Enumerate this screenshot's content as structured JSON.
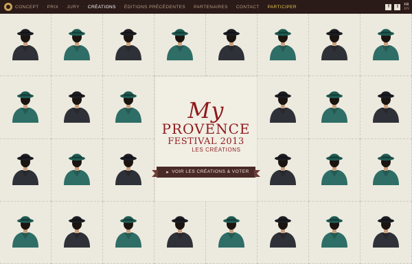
{
  "nav": {
    "items": [
      {
        "label": "Concept",
        "state": "normal"
      },
      {
        "label": "Prix",
        "state": "normal"
      },
      {
        "label": "Jury",
        "state": "normal"
      },
      {
        "label": "Créations",
        "state": "active"
      },
      {
        "label": "Éditions précédentes",
        "state": "normal"
      },
      {
        "label": "Partenaires",
        "state": "normal"
      },
      {
        "label": "Contact",
        "state": "normal"
      },
      {
        "label": "Participer",
        "state": "accent"
      }
    ],
    "social": [
      "f",
      "t"
    ],
    "languages": [
      {
        "label": "FR",
        "current": true
      },
      {
        "label": "EN",
        "current": false
      }
    ]
  },
  "hero": {
    "title_line1": "My",
    "title_line2": "PROVENCE",
    "title_line3": "FESTIVAL 2013",
    "subtitle": "Les créations",
    "cta_label": "Voir les créations & voter"
  },
  "colors": {
    "nav_bg": "#2a1a18",
    "brand_red": "#8d1a1c",
    "coat_teal": "#2e6e66",
    "coat_dark": "#2f3138",
    "background": "#ebe8dc"
  },
  "tiles": [
    "dark",
    "teal",
    "dark",
    "teal",
    "dark",
    "teal",
    "dark",
    "teal",
    "teal",
    "dark",
    "teal",
    "dark",
    "teal",
    "dark",
    "dark",
    "teal",
    "dark",
    "dark",
    "teal",
    "teal",
    "teal",
    "dark",
    "teal",
    "dark",
    "teal",
    "dark",
    "teal",
    "dark"
  ]
}
